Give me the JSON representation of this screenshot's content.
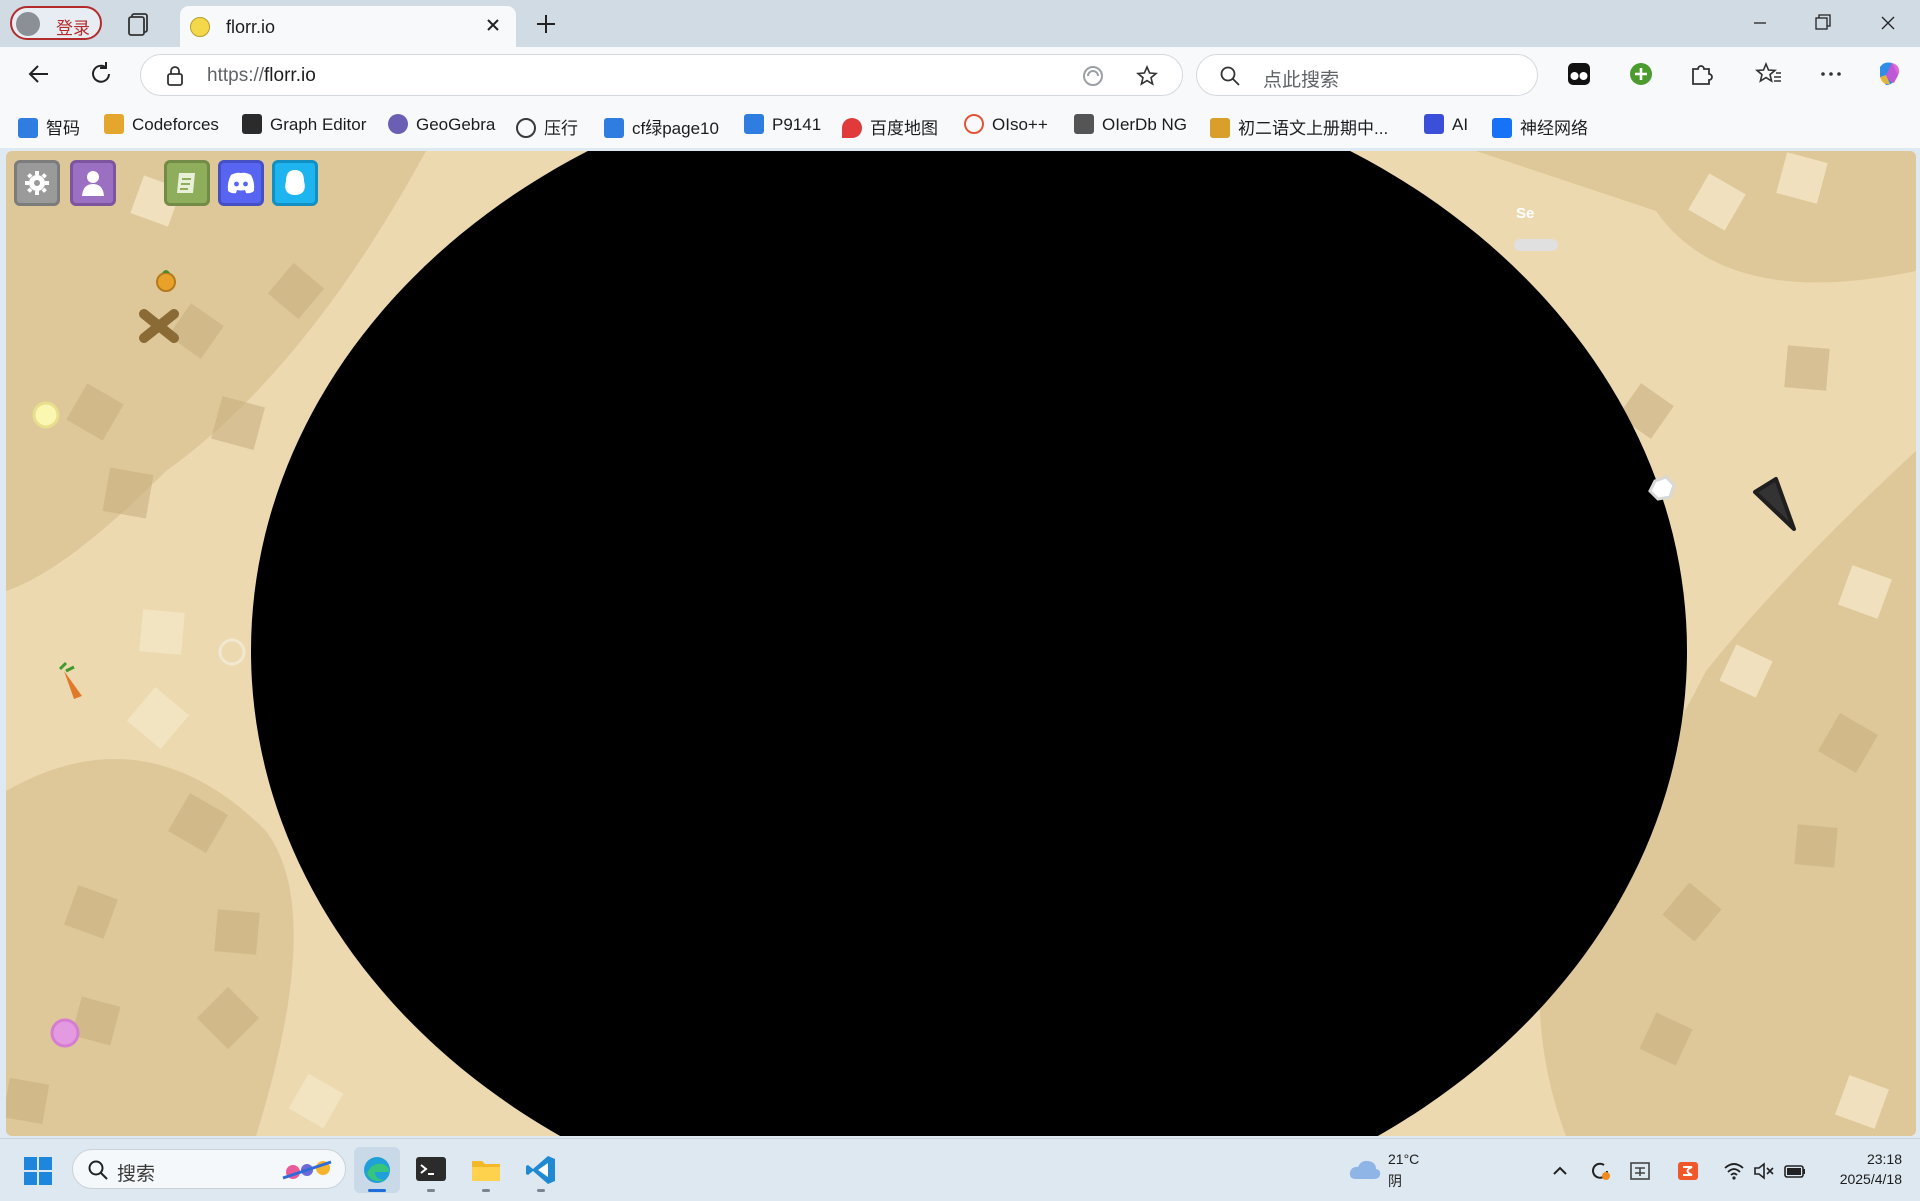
{
  "browser": {
    "profile_label": "登录",
    "tab_title": "florr.io",
    "url_scheme": "https://",
    "url_host": "florr.io",
    "search_placeholder": "点此搜索",
    "bookmarks": [
      {
        "label": "智码",
        "icon": "zhima-icon",
        "color": "#2f7de1"
      },
      {
        "label": "Codeforces",
        "icon": "codeforces-icon",
        "color": "#e4a62c"
      },
      {
        "label": "Graph Editor",
        "icon": "graph-editor-icon",
        "color": "#2b2b2b"
      },
      {
        "label": "GeoGebra",
        "icon": "geogebra-icon",
        "color": "#6b5fb5"
      },
      {
        "label": "压行",
        "icon": "globe-icon",
        "color": "#3a3a3a"
      },
      {
        "label": "cf绿page10",
        "icon": "luogu-icon",
        "color": "#2f7de1"
      },
      {
        "label": "P9141",
        "icon": "luogu-icon",
        "color": "#2f7de1"
      },
      {
        "label": "百度地图",
        "icon": "map-pin-icon",
        "color": "#e03a3a"
      },
      {
        "label": "OIso++",
        "icon": "oiso-icon",
        "color": "#e0553a"
      },
      {
        "label": "OIerDb NG",
        "icon": "oierdb-icon",
        "color": "#555555"
      },
      {
        "label": "初二语文上册期中...",
        "icon": "rainbow-icon",
        "color": "#d8a02b"
      },
      {
        "label": "AI",
        "icon": "ai-icon",
        "color": "#3b4fd8"
      },
      {
        "label": "神经网络",
        "icon": "zhihu-icon",
        "color": "#1772f6"
      }
    ]
  },
  "game": {
    "score_label": "Se",
    "hud_buttons": [
      {
        "name": "settings-icon",
        "color": "#9a9a9a"
      },
      {
        "name": "account-icon",
        "color": "#9b6fc1"
      },
      {
        "name": "changelog-icon",
        "color": "#8fae5c"
      },
      {
        "name": "discord-icon",
        "color": "#5865f2"
      },
      {
        "name": "qq-icon",
        "color": "#1eb4f0"
      }
    ]
  },
  "taskbar": {
    "search_placeholder": "搜索",
    "temperature": "21°C",
    "condition": "阴",
    "time": "23:18",
    "date": "2025/4/18"
  }
}
